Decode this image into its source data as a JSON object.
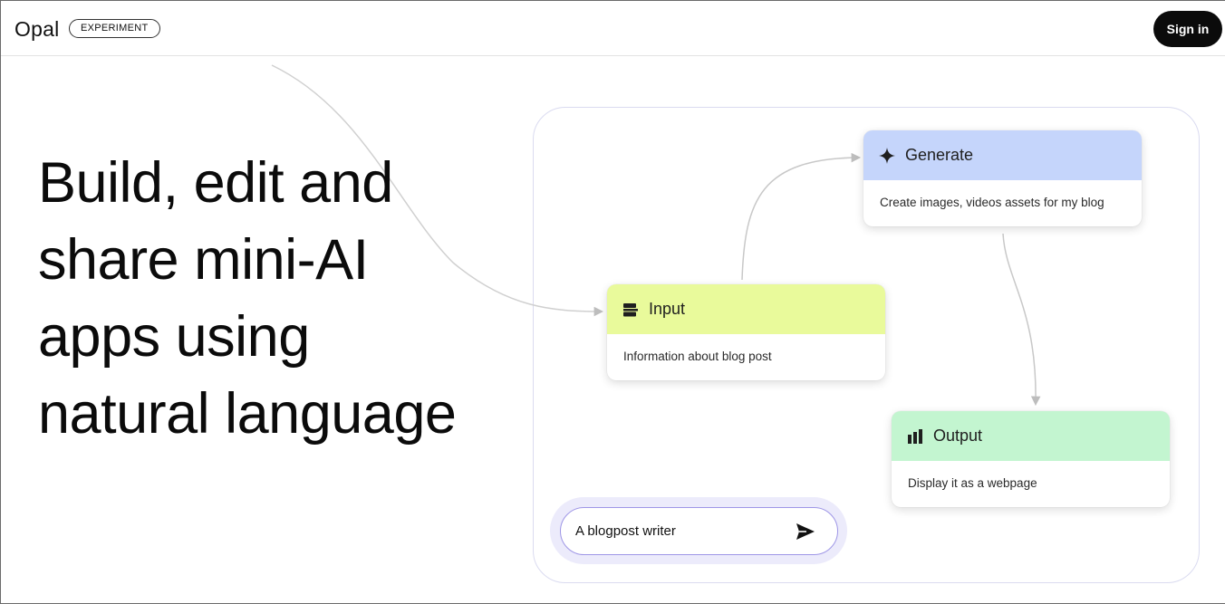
{
  "header": {
    "brand": "Opal",
    "badge": "EXPERIMENT",
    "sign_in_label": "Sign in"
  },
  "hero": {
    "lines": [
      "Build, edit and",
      "share mini-AI",
      "apps using",
      "natural language"
    ]
  },
  "flow": {
    "nodes": [
      {
        "id": "generate",
        "title": "Generate",
        "body": "Create images, videos assets for my blog",
        "icon": "sparkle-icon",
        "color": "#c5d5fb"
      },
      {
        "id": "input",
        "title": "Input",
        "body": "Information about blog post",
        "icon": "input-icon",
        "color": "#e9fa9b"
      },
      {
        "id": "output",
        "title": "Output",
        "body": "Display it as a webpage",
        "icon": "bar-chart-icon",
        "color": "#c3f5d0"
      }
    ]
  },
  "prompt": {
    "value": "A blogpost writer",
    "send_icon": "send-icon"
  },
  "colors": {
    "sign_in_bg": "#0b0b0b",
    "prompt_border": "#9e96e6",
    "connector": "#c8c8c8"
  }
}
